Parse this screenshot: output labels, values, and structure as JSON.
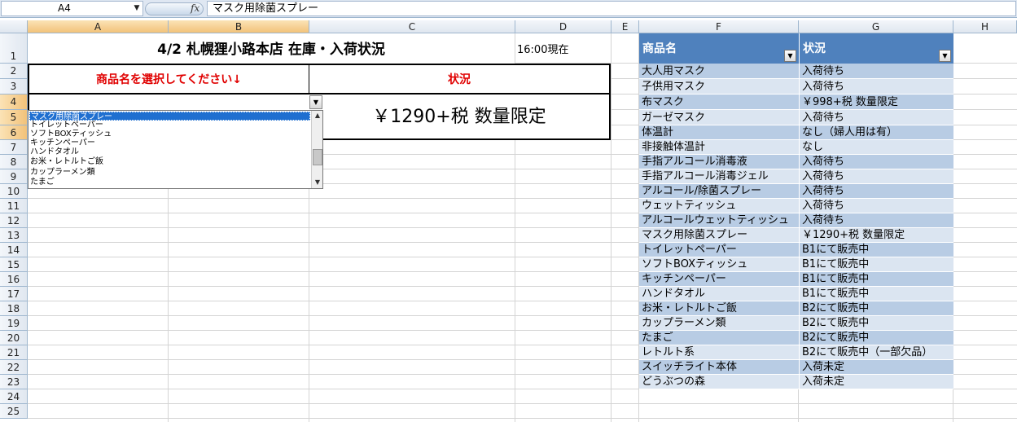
{
  "formula_bar": {
    "cell_ref": "A4",
    "fx": "fx",
    "formula": "マスク用除菌スプレー"
  },
  "columns": [
    "A",
    "B",
    "C",
    "D",
    "E",
    "F",
    "G",
    "H"
  ],
  "rows": [
    "1",
    "2",
    "3",
    "4",
    "5",
    "6",
    "7",
    "8",
    "9",
    "10",
    "11",
    "12",
    "13",
    "14",
    "15",
    "16",
    "17",
    "18",
    "19",
    "20",
    "21",
    "22",
    "23",
    "24",
    "25"
  ],
  "sheet": {
    "title": "4/2 札幌狸小路本店  在庫・入荷状況",
    "timestamp": "16:00現在",
    "select_prompt": "商品名を選択してください↓",
    "status_header": "状況",
    "selected_status": "￥1290+税  数量限定"
  },
  "dropdown": {
    "items": [
      "マスク用除菌スプレー",
      "トイレットペーパー",
      "ソフトBOXティッシュ",
      "キッチンペーパー",
      "ハンドタオル",
      "お米・レトルトご飯",
      "カップラーメン類",
      "たまご"
    ],
    "selected_index": 0
  },
  "table": {
    "header_product": "商品名",
    "header_status": "状況",
    "rows": [
      {
        "product": "大人用マスク",
        "status": "入荷待ち"
      },
      {
        "product": "子供用マスク",
        "status": "入荷待ち"
      },
      {
        "product": "布マスク",
        "status": "￥998+税  数量限定"
      },
      {
        "product": "ガーゼマスク",
        "status": "入荷待ち"
      },
      {
        "product": "体温計",
        "status": "なし（婦人用は有）"
      },
      {
        "product": "非接触体温計",
        "status": "なし"
      },
      {
        "product": "手指アルコール消毒液",
        "status": "入荷待ち"
      },
      {
        "product": "手指アルコール消毒ジェル",
        "status": "入荷待ち"
      },
      {
        "product": "アルコール/除菌スプレー",
        "status": "入荷待ち"
      },
      {
        "product": "ウェットティッシュ",
        "status": "入荷待ち"
      },
      {
        "product": "アルコールウェットティッシュ",
        "status": "入荷待ち"
      },
      {
        "product": "マスク用除菌スプレー",
        "status": "￥1290+税  数量限定"
      },
      {
        "product": "トイレットペーパー",
        "status": "B1にて販売中"
      },
      {
        "product": "ソフトBOXティッシュ",
        "status": "B1にて販売中"
      },
      {
        "product": "キッチンペーパー",
        "status": "B1にて販売中"
      },
      {
        "product": "ハンドタオル",
        "status": "B1にて販売中"
      },
      {
        "product": "お米・レトルトご飯",
        "status": "B2にて販売中"
      },
      {
        "product": "カップラーメン類",
        "status": "B2にて販売中"
      },
      {
        "product": "たまご",
        "status": "B2にて販売中"
      },
      {
        "product": "レトルト系",
        "status": "B2にて販売中（一部欠品）"
      },
      {
        "product": "スイッチライト本体",
        "status": "入荷未定"
      },
      {
        "product": "どうぶつの森",
        "status": "入荷未定"
      }
    ]
  },
  "icons": {
    "namebox_arrow": "▼",
    "dropdown_arrow": "▼",
    "filter_arrow": "▼",
    "scroll_up": "▲",
    "scroll_down": "▼"
  }
}
